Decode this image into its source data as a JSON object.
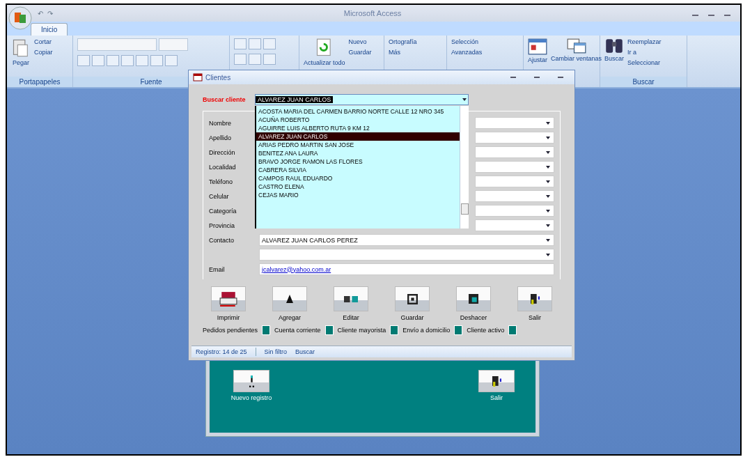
{
  "app": {
    "title": "Microsoft Access",
    "quick_access": [
      "↶",
      "↷"
    ],
    "tabs": [
      {
        "label": "Inicio",
        "selected": true
      }
    ]
  },
  "ribbon": {
    "groups": [
      {
        "label": "Portapapeles",
        "items": [
          {
            "kind": "large",
            "label": "Pegar"
          },
          {
            "kind": "small",
            "label": "Cortar"
          },
          {
            "kind": "small",
            "label": "Copiar"
          }
        ]
      },
      {
        "label": "Fuente",
        "items": [
          {
            "kind": "font"
          }
        ]
      },
      {
        "items": [
          {
            "kind": "align"
          }
        ]
      },
      {
        "items": [
          {
            "kind": "large",
            "label": "Actualizar todo"
          },
          {
            "kind": "small",
            "label": "Nuevo"
          },
          {
            "kind": "small",
            "label": "Guardar"
          }
        ]
      },
      {
        "items": [
          {
            "kind": "small",
            "label": "Ortografía"
          },
          {
            "kind": "small",
            "label": "Más"
          }
        ]
      },
      {
        "items": [
          {
            "kind": "small",
            "label": "Selección"
          },
          {
            "kind": "small",
            "label": "Avanzadas"
          }
        ]
      },
      {
        "items": [
          {
            "kind": "large",
            "label": "Ajustar"
          },
          {
            "kind": "large",
            "label": "Cambiar ventanas"
          }
        ]
      },
      {
        "label": "Buscar",
        "items": [
          {
            "kind": "large",
            "label": "Buscar"
          },
          {
            "kind": "small",
            "label": "Reemplazar"
          },
          {
            "kind": "small",
            "label": "Ir a"
          },
          {
            "kind": "small",
            "label": "Seleccionar"
          }
        ]
      }
    ]
  },
  "dialog": {
    "title": "Clientes",
    "search_label": "Buscar cliente",
    "search_value": "ALVAREZ JUAN CARLOS",
    "list": [
      {
        "text": "ACOSTA MARIA DEL CARMEN BARRIO NORTE CALLE 12 NRO 345",
        "selected": false
      },
      {
        "text": "ACUÑA ROBERTO",
        "selected": false
      },
      {
        "text": "AGUIRRE LUIS ALBERTO RUTA 9 KM 12",
        "selected": false
      },
      {
        "text": "ALVAREZ JUAN CARLOS",
        "selected": true
      },
      {
        "text": "ARIAS PEDRO MARTIN SAN JOSE",
        "selected": false
      },
      {
        "text": "BENITEZ ANA LAURA",
        "selected": false
      },
      {
        "text": "BRAVO JORGE RAMON LAS FLORES",
        "selected": false
      },
      {
        "text": "CABRERA SILVIA",
        "selected": false
      },
      {
        "text": "CAMPOS RAUL EDUARDO",
        "selected": false
      },
      {
        "text": "CASTRO ELENA",
        "selected": false
      },
      {
        "text": "CEJAS MARIO",
        "selected": false
      }
    ],
    "fields": [
      "Nombre",
      "Apellido",
      "Dirección",
      "Localidad",
      "Teléfono",
      "Celular",
      "Categoría",
      "Provincia"
    ],
    "lower_fields": [
      {
        "label": "Contacto",
        "value": "ALVAREZ JUAN CARLOS PEREZ",
        "kind": "combo"
      },
      {
        "kind": "combo"
      },
      {
        "label": "Email",
        "value": "jcalvarez@yahoo.com.ar",
        "kind": "link"
      }
    ],
    "buttons": [
      "Imprimir",
      "Agregar",
      "Editar",
      "Guardar",
      "Deshacer",
      "Salir"
    ],
    "checks": [
      {
        "label": "Pedidos pendientes",
        "checked": true
      },
      {
        "label": "Cuenta corriente",
        "checked": true
      },
      {
        "label": "Cliente mayorista",
        "checked": true
      },
      {
        "label": "Envío a domicilio",
        "checked": true
      },
      {
        "label": "Cliente activo",
        "checked": true
      }
    ],
    "status": {
      "record": "Registro: 14 de 25",
      "filter": "Sin filtro",
      "search": "Buscar"
    }
  },
  "back_form": {
    "buttons": [
      "Nuevo registro",
      "Salir"
    ]
  }
}
